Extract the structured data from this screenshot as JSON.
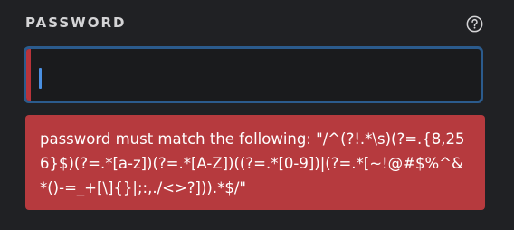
{
  "field": {
    "label": "PASSWORD",
    "help_icon": "question-circle-icon",
    "value": ""
  },
  "error": {
    "message": "password must match the following: \"/^(?!.*\\s)(?=.{8,256}$)(?=.*[a-z])(?=.*[A-Z])((?=.*[0-9])|(?=.*[~!@#$%^&*()-=_+[\\]{}|;:,./<>?])).*$/\""
  },
  "colors": {
    "background": "#202124",
    "input_border_focus": "#2b5b8d",
    "error_background": "#b63a3e",
    "caret": "#4a90e2"
  }
}
